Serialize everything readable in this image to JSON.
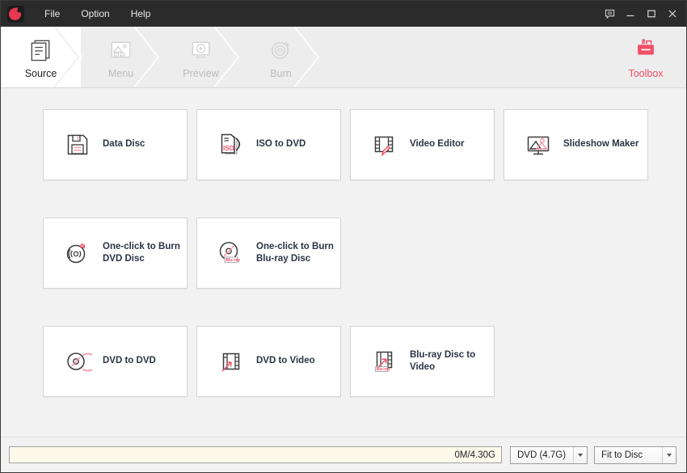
{
  "titlebar": {
    "menus": [
      {
        "label": "File",
        "name": "menu-file"
      },
      {
        "label": "Option",
        "name": "menu-option"
      },
      {
        "label": "Help",
        "name": "menu-help"
      }
    ],
    "controls": {
      "feedback": "feedback-icon",
      "minimize": "minimize-button",
      "maximize": "maximize-button",
      "close": "close-button"
    },
    "logo_name": "app-logo"
  },
  "nav": {
    "steps": [
      {
        "label": "Source",
        "icon": "document-stack-icon",
        "active": true
      },
      {
        "label": "Menu",
        "icon": "image-thumbnails-icon",
        "active": false
      },
      {
        "label": "Preview",
        "icon": "play-monitor-icon",
        "active": false
      },
      {
        "label": "Burn",
        "icon": "burning-disc-icon",
        "active": false
      }
    ],
    "toolbox": {
      "label": "Toolbox",
      "icon": "toolbox-icon",
      "color": "#ef5067"
    }
  },
  "main": {
    "rows": [
      [
        {
          "label": "Data Disc",
          "icon": "floppy-disk-icon"
        },
        {
          "label": "ISO to DVD",
          "icon": "iso-document-disc-icon"
        },
        {
          "label": "Video Editor",
          "icon": "film-strip-pencil-icon"
        },
        {
          "label": "Slideshow Maker",
          "icon": "monitor-photo-icon"
        }
      ],
      [
        {
          "label": "One-click to Burn\nDVD Disc",
          "icon": "disc-flame-icon"
        },
        {
          "label": "One-click to Burn\nBlu-ray Disc",
          "icon": "bluray-disc-flame-icon"
        }
      ],
      [
        {
          "label": "DVD to DVD",
          "icon": "disc-to-disc-icon"
        },
        {
          "label": "DVD to Video",
          "icon": "film-strip-arrow-icon"
        },
        {
          "label": "Blu-ray Disc to\nVideo",
          "icon": "bluray-film-arrow-icon"
        }
      ]
    ]
  },
  "bottombar": {
    "capacity_text": "0M/4.30G",
    "disc_type": "DVD (4.7G)",
    "fit_mode": "Fit to Disc"
  },
  "colors": {
    "accent": "#ef5067",
    "titlebar": "#2b2b2b",
    "content_bg": "#f2f2f2",
    "capacity_bg": "#fdfaec"
  }
}
